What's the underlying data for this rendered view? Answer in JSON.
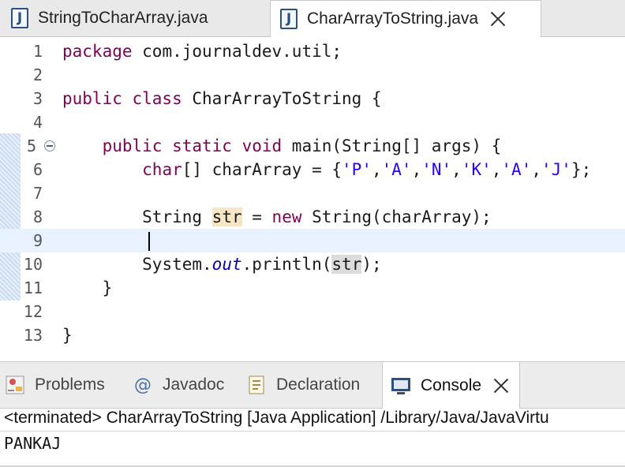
{
  "editor_tabs": [
    {
      "label": "StringToCharArray.java",
      "icon": "java-file-icon"
    },
    {
      "label": "CharArrayToString.java",
      "icon": "java-file-icon",
      "active": true
    }
  ],
  "code": {
    "line_numbers": [
      "1",
      "2",
      "3",
      "4",
      "5",
      "6",
      "7",
      "8",
      "9",
      "10",
      "11",
      "12",
      "13"
    ],
    "l1": {
      "kw": "package",
      "rest": " com.journaldev.util;"
    },
    "l3": {
      "kw": "public class",
      "rest": " CharArrayToString {"
    },
    "l5": {
      "indent": "    ",
      "kw": "public static void",
      "rest": " main(String[] args) {"
    },
    "l6": {
      "indent": "        ",
      "kw": "char",
      "a": "[] charArray = {",
      "s1": "'P'",
      "s2": "'A'",
      "s3": "'N'",
      "s4": "'K'",
      "s5": "'A'",
      "s6": "'J'",
      "comma": ",",
      "end": "};"
    },
    "l8": {
      "indent": "        ",
      "a": "String ",
      "var": "str",
      "b": " = ",
      "kw": "new",
      "c": " String(charArray);"
    },
    "l10": {
      "indent": "        ",
      "a": "System.",
      "field": "out",
      "b": ".println(",
      "var": "str",
      "c": ");"
    },
    "l11": {
      "indent": "    ",
      "text": "}"
    },
    "l13": {
      "text": "}"
    }
  },
  "panel_tabs": [
    {
      "label": "Problems",
      "icon": "problems-icon"
    },
    {
      "label": "Javadoc",
      "icon": "javadoc-at-icon"
    },
    {
      "label": "Declaration",
      "icon": "declaration-icon"
    },
    {
      "label": "Console",
      "icon": "console-monitor-icon",
      "active": true
    }
  ],
  "console": {
    "header": "<terminated> CharArrayToString [Java Application] /Library/Java/JavaVirtu",
    "output": "PANKAJ"
  },
  "colors": {
    "keyword": "#7f0055",
    "string": "#2a00ff",
    "field": "#0000c0",
    "current_line": "#e8f2fe"
  }
}
